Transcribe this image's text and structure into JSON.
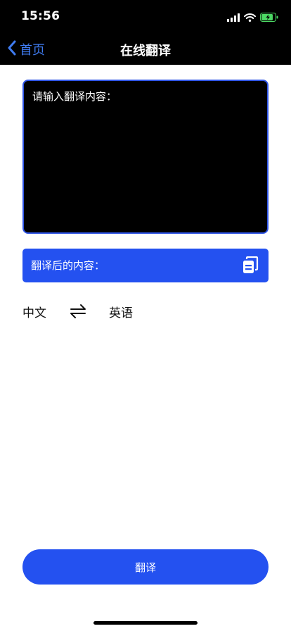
{
  "status_bar": {
    "time": "15:56"
  },
  "nav": {
    "back_label": "首页",
    "title": "在线翻译"
  },
  "input": {
    "placeholder": "请输入翻译内容："
  },
  "result": {
    "label": "翻译后的内容："
  },
  "languages": {
    "source": "中文",
    "target": "英语"
  },
  "actions": {
    "translate_label": "翻译"
  },
  "colors": {
    "accent": "#2451f0",
    "back_link": "#3f7bf0",
    "header_bg": "#000000",
    "battery_charging": "#4cd964"
  },
  "icons": {
    "status": [
      "signal-icon",
      "wifi-icon",
      "battery-charging-icon"
    ],
    "back": "chevron-left-icon",
    "copy": "copy-icon",
    "swap": "swap-arrows-icon"
  }
}
